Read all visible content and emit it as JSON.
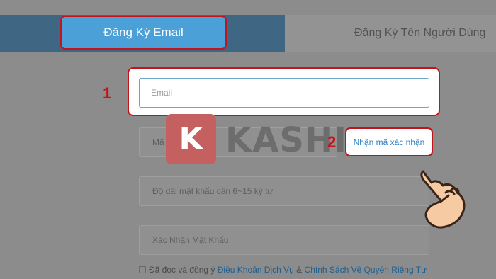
{
  "tabs": {
    "email_label": "Đăng Ký Email",
    "username_label": "Đăng Ký Tên Người Dùng"
  },
  "form": {
    "email_placeholder": "Email",
    "code_placeholder": "Mã Xác Nhận",
    "get_code_label": "Nhận mã xác nhận",
    "password_placeholder": "Độ dài mật khẩu cần 6~15 ký tự",
    "confirm_placeholder": "Xác Nhận Mật Khẩu"
  },
  "terms": {
    "prefix": "Đã đọc và đồng ý",
    "link1": "Điều Khoản Dịch Vụ",
    "separator": "&",
    "link2": "Chính Sách Về Quyền Riêng Tư"
  },
  "annotations": {
    "step1": "1",
    "step2": "2"
  },
  "watermark": {
    "letter": "K",
    "word": "KASHI"
  },
  "icons": {
    "pointer": "pointing-hand-icon"
  },
  "colors": {
    "highlight": "#c4141b",
    "tab_active": "#3f6784",
    "button": "#4ca0d8",
    "link": "#2d7fc2"
  }
}
